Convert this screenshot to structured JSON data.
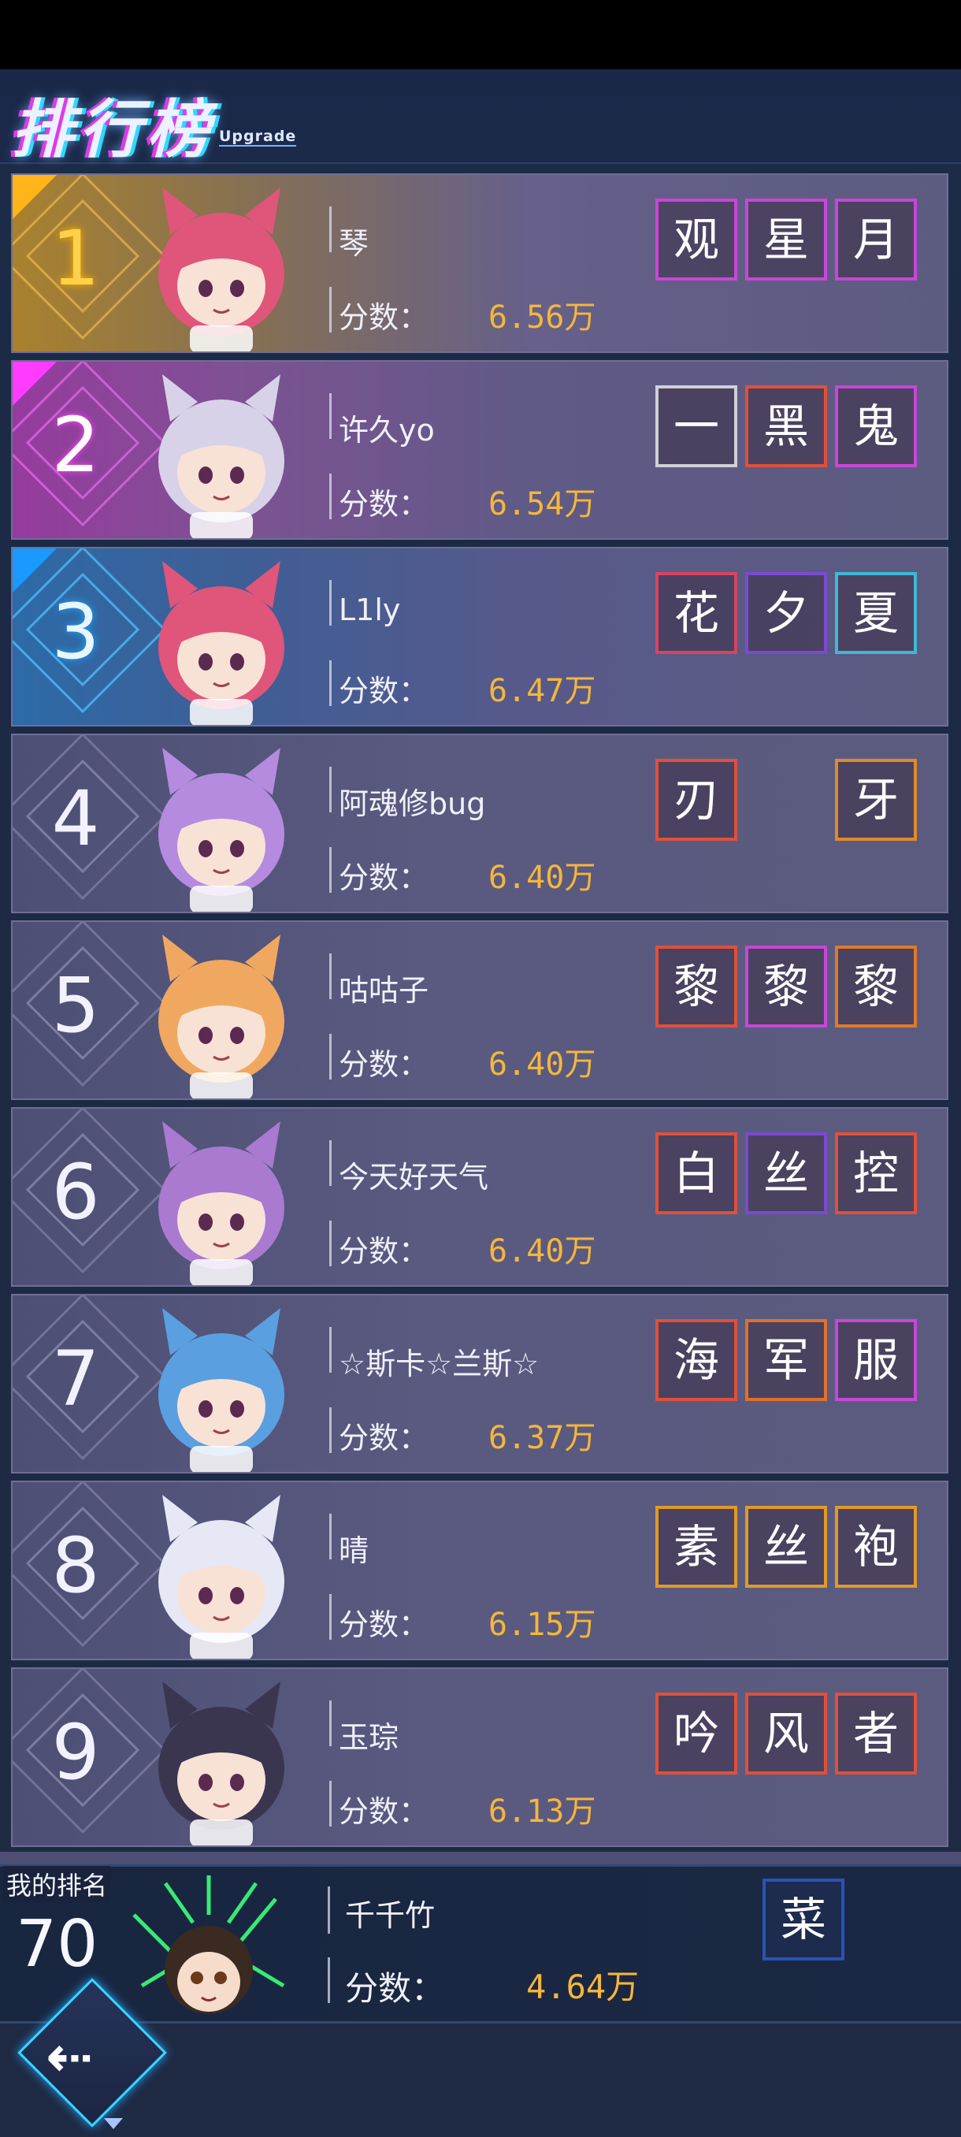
{
  "header": {
    "title": "排行榜",
    "subtitle": "Upgrade"
  },
  "score_label": "分数：",
  "entries": [
    {
      "rank": "1",
      "name": "琴",
      "score": "6.56万",
      "tags": [
        "观",
        "星",
        "月"
      ],
      "tag_colors": [
        "#c846d8",
        "#c846d8",
        "#c846d8"
      ]
    },
    {
      "rank": "2",
      "name": "许久yo",
      "score": "6.54万",
      "tags": [
        "一",
        "黑",
        "鬼"
      ],
      "tag_colors": [
        "#cfcfd8",
        "#e0503a",
        "#c846d8"
      ]
    },
    {
      "rank": "3",
      "name": "L1ly",
      "score": "6.47万",
      "tags": [
        "花",
        "夕",
        "夏"
      ],
      "tag_colors": [
        "#d64560",
        "#7a4bd0",
        "#3fb8d8"
      ]
    },
    {
      "rank": "4",
      "name": "阿魂修bug",
      "score": "6.40万",
      "tags": [
        "刃",
        "",
        "牙"
      ],
      "tag_colors": [
        "#e0503a",
        "",
        "#e08a2a"
      ]
    },
    {
      "rank": "5",
      "name": "咕咕子",
      "score": "6.40万",
      "tags": [
        "黎",
        "黎",
        "黎"
      ],
      "tag_colors": [
        "#e0503a",
        "#c846d8",
        "#e07a2a"
      ]
    },
    {
      "rank": "6",
      "name": "今天好天气",
      "score": "6.40万",
      "tags": [
        "白",
        "丝",
        "控"
      ],
      "tag_colors": [
        "#e0503a",
        "#7a4bd0",
        "#e0503a"
      ]
    },
    {
      "rank": "7",
      "name": "☆斯卡☆兰斯☆",
      "score": "6.37万",
      "tags": [
        "海",
        "军",
        "服"
      ],
      "tag_colors": [
        "#e0503a",
        "#e0702a",
        "#c846d8"
      ]
    },
    {
      "rank": "8",
      "name": "晴",
      "score": "6.15万",
      "tags": [
        "素",
        "丝",
        "袍"
      ],
      "tag_colors": [
        "#e09a2a",
        "#e09a2a",
        "#e09a2a"
      ]
    },
    {
      "rank": "9",
      "name": "玉琮",
      "score": "6.13万",
      "tags": [
        "吟",
        "风",
        "者"
      ],
      "tag_colors": [
        "#e0503a",
        "#e0503a",
        "#e0503a"
      ]
    }
  ],
  "mine": {
    "label": "我的排名",
    "rank": "70",
    "name": "千千竹",
    "score": "4.64万",
    "tag": "菜"
  },
  "icons": {
    "back": "back-arrow-icon"
  }
}
